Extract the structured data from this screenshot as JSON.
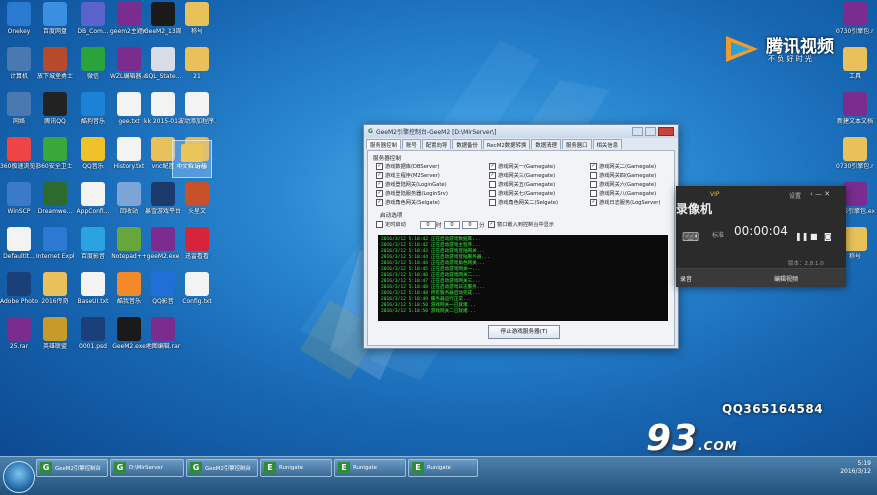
{
  "desktop": {
    "icons": [
      {
        "label": "Onekey",
        "color": "#2a7ad1",
        "x": 0
      },
      {
        "label": "百度网盘",
        "color": "#3a8fe0",
        "x": 0
      },
      {
        "label": "DB_Com...",
        "color": "#5b62c9",
        "x": 0
      },
      {
        "label": "geem2主题mp4.rar",
        "color": "#7a2c8f",
        "x": 0
      },
      {
        "label": "GeeM2_13周年登录...",
        "color": "#1a1a1a",
        "x": 0
      },
      {
        "label": "称号",
        "color": "#e8c15a",
        "x": 0
      },
      {
        "label": "计算机",
        "color": "#4a78b0",
        "x": 0
      },
      {
        "label": "放下城堡勇士",
        "color": "#b64a2a",
        "x": 0
      },
      {
        "label": "微信",
        "color": "#2aa33a",
        "x": 0
      },
      {
        "label": "WZL编辑器.exe",
        "color": "#7a2c8f",
        "x": 0
      },
      {
        "label": "SQL_State...",
        "color": "#d8dde6",
        "x": 0
      },
      {
        "label": "21",
        "color": "#e8c15a",
        "x": 0
      },
      {
        "label": "网络",
        "color": "#4a78b0",
        "x": 0
      },
      {
        "label": "腾讯QQ",
        "color": "#222",
        "x": 0
      },
      {
        "label": "酷狗音乐",
        "color": "#1b82d6",
        "x": 0
      },
      {
        "label": "gee.txt",
        "color": "#f3f3f3",
        "x": 0
      },
      {
        "label": "kk 2015-01-...",
        "color": "#f3f3f3",
        "x": 0
      },
      {
        "label": "波动添加程序.txt",
        "color": "#f3f3f3",
        "x": 0
      },
      {
        "label": "360极速浏览器",
        "color": "#e44",
        "x": 0
      },
      {
        "label": "360安全卫士",
        "color": "#39a83a",
        "x": 0
      },
      {
        "label": "QQ音乐",
        "color": "#f0c22a",
        "x": 0
      },
      {
        "label": "History.txt",
        "color": "#f3f3f3",
        "x": 0
      },
      {
        "label": "vnc配置",
        "color": "#e8c15a",
        "x": 0
      },
      {
        "label": "YY语音",
        "color": "#f2b62a",
        "x": 0
      },
      {
        "label": "WinSCP",
        "color": "#3a7ac8",
        "x": 0
      },
      {
        "label": "Dreamwe...",
        "color": "#2d6a2d",
        "x": 0
      },
      {
        "label": "AppConfi...",
        "color": "#f3f3f3",
        "x": 0
      },
      {
        "label": "回收站",
        "color": "#7aa5d6",
        "x": 0
      },
      {
        "label": "暴雪游戏平台",
        "color": "#1b3a6b",
        "x": 0
      },
      {
        "label": "火星文",
        "color": "#c8502a",
        "x": 0
      },
      {
        "label": "Defaultlt...",
        "color": "#f3f3f3",
        "x": 0
      },
      {
        "label": "Internet Explorer",
        "color": "#2b79d0",
        "x": 0
      },
      {
        "label": "百度影音",
        "color": "#2aa3e0",
        "x": 0
      },
      {
        "label": "Notepad++",
        "color": "#67a63a",
        "x": 0
      },
      {
        "label": "geeM2.exe",
        "color": "#7a2c8f",
        "x": 0
      },
      {
        "label": "迅雷看看",
        "color": "#d6253a",
        "x": 0
      },
      {
        "label": "Adobe Photosh...",
        "color": "#1b3f78",
        "x": 0
      },
      {
        "label": "2016传奇",
        "color": "#e8c15a",
        "x": 0
      },
      {
        "label": "BaseUI.txt",
        "color": "#f3f3f3",
        "x": 0
      },
      {
        "label": "酷我音乐",
        "color": "#f28a2a",
        "x": 0
      },
      {
        "label": "QQ影音",
        "color": "#1f6fd6",
        "x": 0
      },
      {
        "label": "Config.txt",
        "color": "#f3f3f3",
        "x": 0
      },
      {
        "label": "25.rar",
        "color": "#7a2c8f",
        "x": 0
      },
      {
        "label": "英雄联盟",
        "color": "#c89a2a",
        "x": 0
      },
      {
        "label": "0001.psd",
        "color": "#1b3f78",
        "x": 0
      },
      {
        "label": "GeeM2.exe",
        "color": "#1a1a1a",
        "x": 0
      },
      {
        "label": "地图编辑.rar",
        "color": "#7a2c8f",
        "x": 0
      }
    ],
    "right_icons": [
      "0730引擎包.rar",
      "工具",
      "新建文本文档",
      "0730引擎包.rar",
      "赤影引擎包.exe",
      "称号"
    ],
    "logo_text": "腾讯视频",
    "logo_sub": "不 负 好 时 光",
    "selected_icon": "中文名.bmp"
  },
  "window": {
    "title": "GeeM2引擎控制台-GeeM2 [D:\\MirServer\\]",
    "tabs": [
      "服务器控制",
      "账号",
      "配置向导",
      "数据备份",
      "RecM2数据转换",
      "数据清理",
      "服务器口",
      "相关信息"
    ],
    "group_label": "服务器控制",
    "checks": [
      {
        "label": "游戏数据库(DBServer)",
        "checked": true
      },
      {
        "label": "游戏网关一(Gamegate)",
        "checked": true
      },
      {
        "label": "游戏网关二(Gamegate)",
        "checked": true
      },
      {
        "label": "游戏主程序(M2Server)",
        "checked": true
      },
      {
        "label": "游戏网关三(Gamegate)",
        "checked": true
      },
      {
        "label": "游戏网关四(Gamegate)",
        "checked": false
      },
      {
        "label": "游戏登陆网关(LoginGate)",
        "checked": true
      },
      {
        "label": "游戏网关五(Gamegate)",
        "checked": false
      },
      {
        "label": "游戏网关六(Gamegate)",
        "checked": false
      },
      {
        "label": "游戏登陆服务器(LoginSrv)",
        "checked": true
      },
      {
        "label": "游戏网关七(Gamegate)",
        "checked": false
      },
      {
        "label": "游戏网关八(Gamegate)",
        "checked": false
      },
      {
        "label": "游戏角色网关(Selgate)",
        "checked": true
      },
      {
        "label": "游戏角色网关二(Selgate)",
        "checked": false
      },
      {
        "label": "游戏日志服务(LogServer)",
        "checked": true
      }
    ],
    "auto_label": "启动选项",
    "timer_label": "定时启动",
    "timer_hour": "0",
    "timer_min": "0",
    "timer_sep": "0",
    "timer_unit1": "时",
    "timer_unit2": "分",
    "tray_option": "窗口嵌入到控制台中显示",
    "log_lines": [
      "2016/3/12 5:18:42 正在启动游戏数据库...",
      "2016/3/12 5:18:42 正在启动游戏主程序...",
      "2016/3/12 5:18:43 正在启动游戏登陆网关...",
      "2016/3/12 5:18:44 正在启动游戏登陆服务器...",
      "2016/3/12 5:18:44 正在启动游戏角色网关...",
      "2016/3/12 5:18:45 正在启动游戏网关一...",
      "2016/3/12 5:18:46 正在启动游戏网关二...",
      "2016/3/12 5:18:47 正在启动游戏网关三...",
      "2016/3/12 5:18:48 正在启动游戏日志服务...",
      "2016/3/12 5:18:48 所有服务器启动完成...",
      "2016/3/12 5:18:49 服务器运行正常...",
      "2016/3/12 5:18:50 游戏网关一已就绪...",
      "2016/3/12 5:18:50 游戏网关二已就绪..."
    ],
    "stop_button": "停止游戏服务器(T)"
  },
  "recorder": {
    "vip": "VIP",
    "settings": "设置",
    "title": "录像机",
    "record_label": "标准",
    "time": "00:00:04",
    "version": "版本：2.8.1.0",
    "btn_left": "录音",
    "btn_right": "编辑视频"
  },
  "overlay": {
    "qq": "QQ365164584",
    "watermark": "93",
    "watermark_dot": ".COM"
  },
  "taskbar": {
    "items": [
      "GeeM2引擎控制台",
      "D:\\MirServer",
      "GeeM2引擎控制台",
      "Runigate",
      "Runigate",
      "Runigate"
    ],
    "time": "5:19",
    "date": "2016/3/12"
  }
}
